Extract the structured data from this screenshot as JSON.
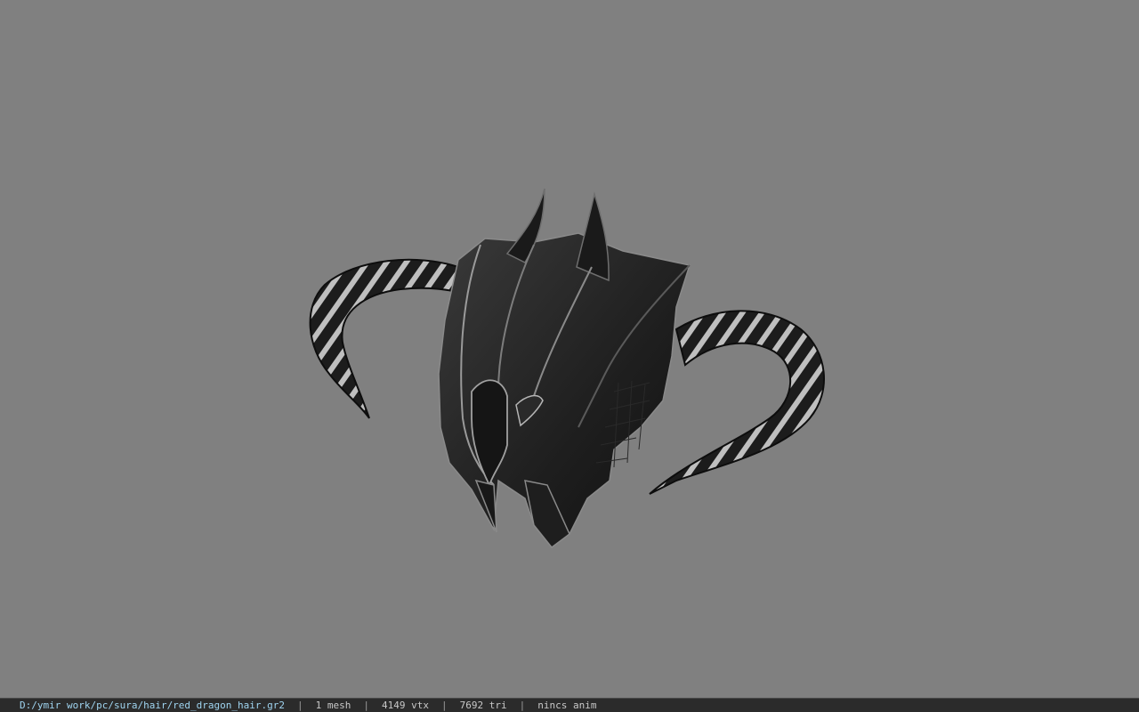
{
  "viewport": {
    "background": "#808080",
    "model_icon": "horned-dragon-helmet-icon"
  },
  "status_bar": {
    "file_path": "D:/ymir work/pc/sura/hair/red_dragon_hair.gr2",
    "separator": "|",
    "mesh_count": "1 mesh",
    "vertex_count": "4149 vtx",
    "triangle_count": "7692 tri",
    "anim_status": "nincs anim",
    "path_color": "#9fd4f0",
    "text_color": "#c8c8c8"
  }
}
